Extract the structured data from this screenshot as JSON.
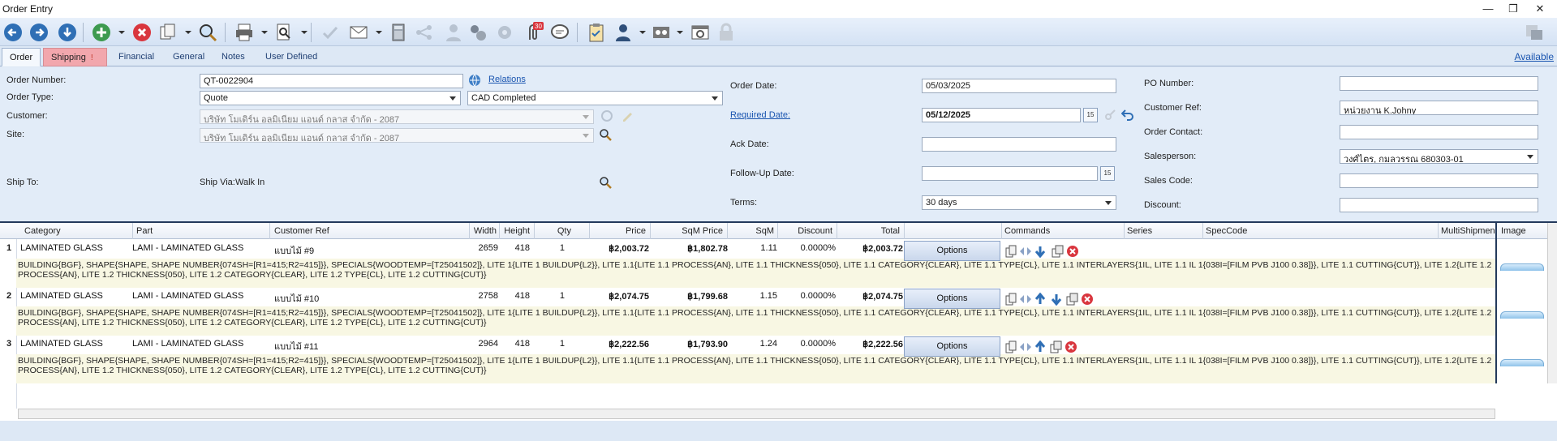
{
  "window": {
    "title": "Order Entry"
  },
  "tabs": [
    {
      "label": "Order",
      "active": true
    },
    {
      "label": "Shipping",
      "indicator": "!"
    },
    {
      "label": "Financial"
    },
    {
      "label": "General"
    },
    {
      "label": "Notes"
    },
    {
      "label": "User Defined"
    }
  ],
  "available_link": "Available",
  "form": {
    "order_number": {
      "label": "Order Number:",
      "value": "QT-0022904"
    },
    "relations_link": "Relations",
    "order_type": {
      "label": "Order Type:",
      "value": "Quote",
      "status": "CAD Completed"
    },
    "customer": {
      "label": "Customer:",
      "value": "บริษัท โมเดิร์น อลูมิเนียม แอนด์ กลาส  จำกัด - 2087"
    },
    "site": {
      "label": "Site:",
      "value": "บริษัท โมเดิร์น อลูมิเนียม แอนด์ กลาส  จำกัด - 2087"
    },
    "ship_to": {
      "label": "Ship To:"
    },
    "ship_via": {
      "label": "Ship Via:",
      "value": "Walk In"
    },
    "order_date": {
      "label": "Order Date:",
      "value": "05/03/2025"
    },
    "required_date": {
      "label": "Required Date:",
      "value": "05/12/2025"
    },
    "ack_date": {
      "label": "Ack Date:",
      "value": ""
    },
    "follow_up_date": {
      "label": "Follow-Up Date:",
      "value": ""
    },
    "terms": {
      "label": "Terms:",
      "value": "30 days"
    },
    "po_number": {
      "label": "PO Number:",
      "value": ""
    },
    "customer_ref": {
      "label": "Customer Ref:",
      "value": "หน่วยงาน K.Johny"
    },
    "order_contact": {
      "label": "Order Contact:",
      "value": ""
    },
    "salesperson": {
      "label": "Salesperson:",
      "value": "วงศ์ไตร, กมลวรรณ   680303-01"
    },
    "sales_code": {
      "label": "Sales Code:",
      "value": ""
    },
    "discount": {
      "label": "Discount:",
      "value": ""
    },
    "calendar_glyph": "15"
  },
  "grid": {
    "columns": [
      "Category",
      "Part",
      "Customer Ref",
      "Width",
      "Height",
      "Qty",
      "Price",
      "SqM Price",
      "SqM",
      "Discount",
      "Total",
      "Commands",
      "Series",
      "SpecCode",
      "MultiShipmen"
    ],
    "image_column": "Image",
    "options_label": "Options",
    "rows": [
      {
        "num": "1",
        "category": "LAMINATED GLASS",
        "part": "LAMI - LAMINATED GLASS",
        "customer_ref": "แบบไม้ #9",
        "width": "2659",
        "height": "418",
        "qty": "1",
        "price": "฿2,003.72",
        "sqm_price": "฿1,802.78",
        "sqm": "1.11",
        "discount": "0.0000%",
        "total": "฿2,003.72",
        "desc": "BUILDING{BGF}, SHAPE{SHAPE, SHAPE NUMBER{074SH=[R1=415;R2=415]}}, SPECIALS{WOODTEMP=[T25041502]}, LITE 1{LITE 1 BUILDUP{L2}}, LITE 1.1{LITE 1.1 PROCESS{AN}, LITE 1.1 THICKNESS{050}, LITE 1.1 CATEGORY{CLEAR}, LITE 1.1 TYPE{CL}, LITE 1.1 INTERLAYERS{1IL, LITE 1.1 IL 1{038I=[FILM PVB J100 0.38]}}, LITE 1.1 CUTTING{CUT}}, LITE 1.2{LITE 1.2 PROCESS{AN}, LITE 1.2 THICKNESS{050}, LITE 1.2 CATEGORY{CLEAR}, LITE 1.2 TYPE{CL}, LITE 1.2 CUTTING{CUT}}"
      },
      {
        "num": "2",
        "category": "LAMINATED GLASS",
        "part": "LAMI - LAMINATED GLASS",
        "customer_ref": "แบบไม้ #10",
        "width": "2758",
        "height": "418",
        "qty": "1",
        "price": "฿2,074.75",
        "sqm_price": "฿1,799.68",
        "sqm": "1.15",
        "discount": "0.0000%",
        "total": "฿2,074.75",
        "desc": "BUILDING{BGF}, SHAPE{SHAPE, SHAPE NUMBER{074SH=[R1=415;R2=415]}}, SPECIALS{WOODTEMP=[T25041502]}, LITE 1{LITE 1 BUILDUP{L2}}, LITE 1.1{LITE 1.1 PROCESS{AN}, LITE 1.1 THICKNESS{050}, LITE 1.1 CATEGORY{CLEAR}, LITE 1.1 TYPE{CL}, LITE 1.1 INTERLAYERS{1IL, LITE 1.1 IL 1{038I=[FILM PVB J100 0.38]}}, LITE 1.1 CUTTING{CUT}}, LITE 1.2{LITE 1.2 PROCESS{AN}, LITE 1.2 THICKNESS{050}, LITE 1.2 CATEGORY{CLEAR}, LITE 1.2 TYPE{CL}, LITE 1.2 CUTTING{CUT}}"
      },
      {
        "num": "3",
        "category": "LAMINATED GLASS",
        "part": "LAMI - LAMINATED GLASS",
        "customer_ref": "แบบไม้ #11",
        "width": "2964",
        "height": "418",
        "qty": "1",
        "price": "฿2,222.56",
        "sqm_price": "฿1,793.90",
        "sqm": "1.24",
        "discount": "0.0000%",
        "total": "฿2,222.56",
        "desc": "BUILDING{BGF}, SHAPE{SHAPE, SHAPE NUMBER{074SH=[R1=415;R2=415]}}, SPECIALS{WOODTEMP=[T25041502]}, LITE 1{LITE 1 BUILDUP{L2}}, LITE 1.1{LITE 1.1 PROCESS{AN}, LITE 1.1 THICKNESS{050}, LITE 1.1 CATEGORY{CLEAR}, LITE 1.1 TYPE{CL}, LITE 1.1 INTERLAYERS{1IL, LITE 1.1 IL 1{038I=[FILM PVB J100 0.38]}}, LITE 1.1 CUTTING{CUT}}, LITE 1.2{LITE 1.2 PROCESS{AN}, LITE 1.2 THICKNESS{050}, LITE 1.2 CATEGORY{CLEAR}, LITE 1.2 TYPE{CL}, LITE 1.2 CUTTING{CUT}}"
      }
    ]
  },
  "toolbar": {
    "badge": "30",
    "icons": [
      "back-icon",
      "forward-icon",
      "download-icon",
      "add-icon",
      "cancel-icon",
      "copy-icon",
      "search-icon",
      "print-icon",
      "preview-icon",
      "check-icon",
      "email-icon",
      "calculator-icon",
      "share-icon",
      "user-icon",
      "settings-icon",
      "gear-icon",
      "attachment-icon",
      "chat-icon",
      "clipboard-icon",
      "person-icon",
      "tape-icon",
      "camera-icon",
      "lock-icon",
      "layout-icon"
    ]
  },
  "colors": {
    "accent": "#1a55b0",
    "shipping_tab": "#f2a7ad",
    "toolbar_blue": "#2f6fb5",
    "delete_red": "#d9363e"
  }
}
